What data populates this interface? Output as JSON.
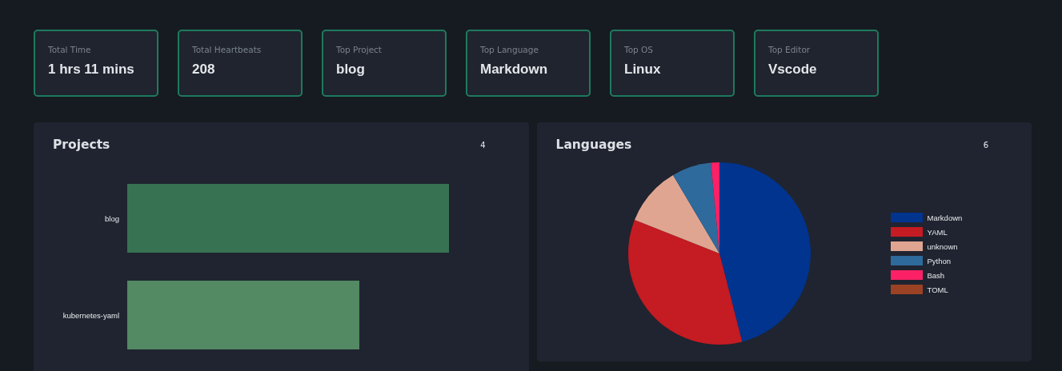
{
  "stats": [
    {
      "label": "Total Time",
      "value": "1 hrs 11 mins"
    },
    {
      "label": "Total Heartbeats",
      "value": "208"
    },
    {
      "label": "Top Project",
      "value": "blog"
    },
    {
      "label": "Top Language",
      "value": "Markdown"
    },
    {
      "label": "Top OS",
      "value": "Linux"
    },
    {
      "label": "Top Editor",
      "value": "Vscode"
    }
  ],
  "projects": {
    "title": "Projects",
    "count": "4",
    "bars": [
      {
        "label": "blog",
        "color": "#377352"
      },
      {
        "label": "kubernetes-yaml",
        "color": "#538963"
      }
    ]
  },
  "languages": {
    "title": "Languages",
    "count": "6",
    "legend": [
      {
        "label": "Markdown",
        "color": "#01348f"
      },
      {
        "label": "YAML",
        "color": "#c51b22"
      },
      {
        "label": "unknown",
        "color": "#e0a591"
      },
      {
        "label": "Python",
        "color": "#2f6a9c"
      },
      {
        "label": "Bash",
        "color": "#fc2166"
      },
      {
        "label": "TOML",
        "color": "#9b4224"
      }
    ]
  }
}
